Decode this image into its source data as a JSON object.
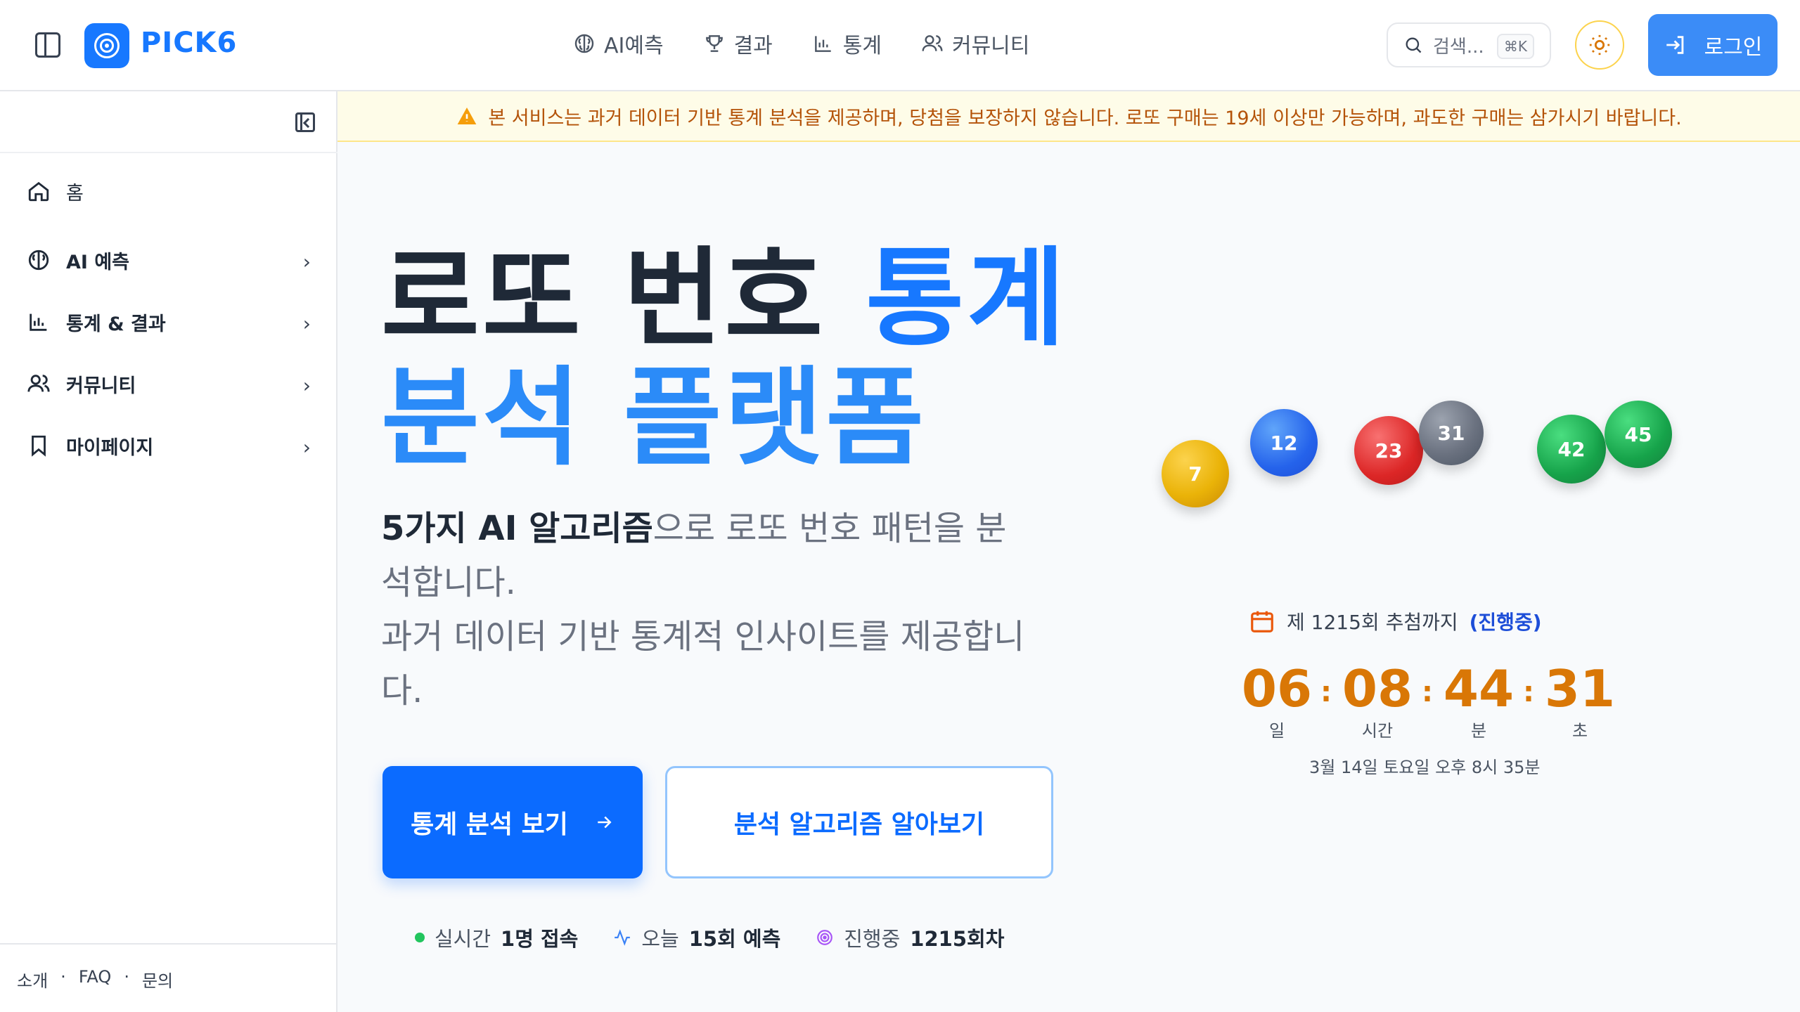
{
  "header": {
    "logo_text": "PICK6",
    "nav": [
      "AI예측",
      "결과",
      "통계",
      "커뮤니티"
    ],
    "search_placeholder": "검색...",
    "search_shortcut": "⌘K",
    "login_label": "로그인",
    "accent_color": "#1778ff"
  },
  "sidebar": {
    "items": [
      {
        "label": "홈",
        "icon": "home-icon"
      },
      {
        "label": "AI 예측",
        "icon": "brain-icon"
      },
      {
        "label": "통계 & 결과",
        "icon": "chart-icon"
      },
      {
        "label": "커뮤니티",
        "icon": "users-icon"
      },
      {
        "label": "마이페이지",
        "icon": "bookmark-icon"
      }
    ],
    "footer": [
      "소개",
      "·",
      "FAQ",
      "·",
      "문의"
    ]
  },
  "banner": {
    "text": "본 서비스는 과거 데이터 기반 통계 분석을 제공하며, 당첨을 보장하지 않습니다. 로또 구매는 19세 이상만 가능하며, 과도한 구매는 삼가시기 바랍니다."
  },
  "hero": {
    "title_part1": "로또 번호 ",
    "title_part2": "통계",
    "title_part3": "분석 플랫폼",
    "subtitle_bold": "5가지 AI 알고리즘",
    "subtitle_rest": "으로 로또 번호 패턴을 분석합니다.",
    "subtitle_line2": "과거 데이터 기반 통계적 인사이트를 제공합니다.",
    "primary_button": "통계 분석 보기",
    "secondary_button": "분석 알고리즘 알아보기"
  },
  "stats": {
    "live_label": "실시간",
    "live_value": "1명 접속",
    "today_label": "오늘",
    "today_value": "15회 예측",
    "ongoing_label": "진행중",
    "ongoing_value": "1215회차"
  },
  "balls": [
    "7",
    "12",
    "23",
    "31",
    "42",
    "45"
  ],
  "countdown": {
    "draw_label": "제 1215회 추첨까지",
    "status": "(진행중)",
    "days": "06",
    "hours": "08",
    "minutes": "44",
    "seconds": "31",
    "days_label": "일",
    "hours_label": "시간",
    "minutes_label": "분",
    "seconds_label": "초",
    "separator": ":",
    "draw_date": "3월 14일 토요일 오후 8시 35분"
  }
}
